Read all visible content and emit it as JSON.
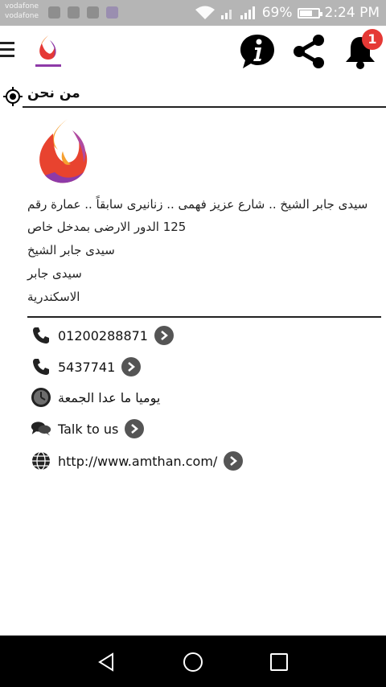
{
  "status_bar": {
    "carriers": [
      "vodafone",
      "vodafone"
    ],
    "battery": "69%",
    "battery_level": 0.69,
    "time": "2:24 PM"
  },
  "header": {
    "menu_icon": "hamburger-icon",
    "info_icon": "info-icon",
    "share_icon": "share-icon",
    "bell_icon": "bell-icon",
    "notification_count": "1"
  },
  "section": {
    "title": "من نحن",
    "title_icon": "target-icon"
  },
  "address": {
    "full": "سيدى جابر الشيخ .. شارع عزيز فهمى .. زنانيرى سابقاً .. عمارة رقم 125 الدور الارضى بمدخل خاص",
    "lines": [
      "سيدى جابر الشيخ",
      "سيدى جابر",
      "الاسكندرية"
    ]
  },
  "contacts": [
    {
      "icon": "phone-icon",
      "text": "01200288871"
    },
    {
      "icon": "phone-icon",
      "text": "5437741"
    },
    {
      "icon": "clock-icon",
      "text": "يوميا ما عدا الجمعة"
    },
    {
      "icon": "chat-icon",
      "text": "Talk to us"
    },
    {
      "icon": "globe-icon",
      "text": "http://www.amthan.com/"
    }
  ],
  "colors": {
    "status_bar": "#b5b5b5",
    "badge": "#e53935",
    "logo_orange": "#f57c28",
    "logo_purple": "#8e3aa8",
    "arrow_button": "#555555"
  }
}
